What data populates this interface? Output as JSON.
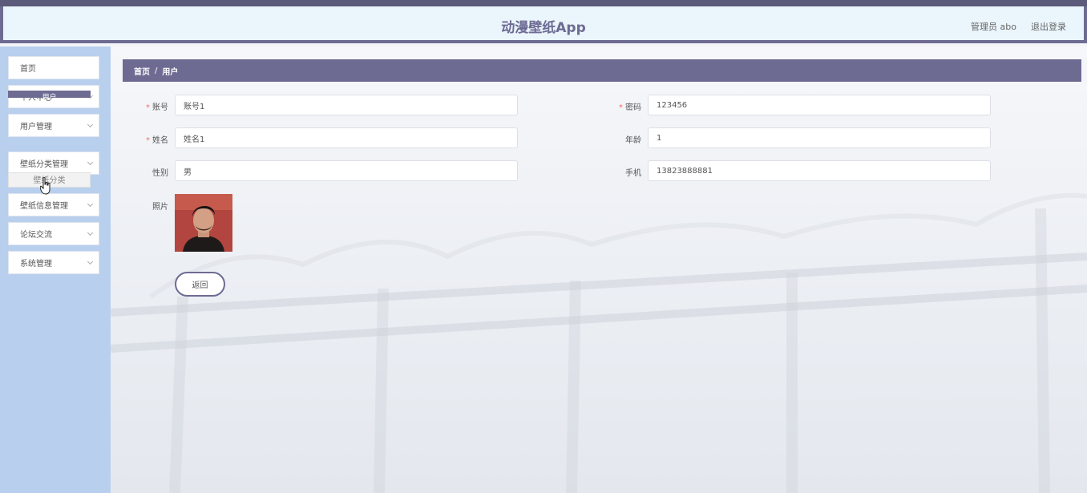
{
  "header": {
    "app_title": "动漫壁纸App",
    "admin_label": "管理员 abo",
    "logout_label": "退出登录"
  },
  "sidebar": {
    "items": [
      {
        "label": "首页"
      },
      {
        "label": "个人中心"
      },
      {
        "label": "用户管理"
      },
      {
        "label": "壁纸分类管理"
      },
      {
        "label": "壁纸信息管理"
      },
      {
        "label": "论坛交流"
      },
      {
        "label": "系统管理"
      }
    ],
    "submenu_user": "用户",
    "submenu_category": "壁纸分类"
  },
  "breadcrumb": {
    "home": "首页",
    "separator": "/",
    "current": "用户"
  },
  "form": {
    "account": {
      "label": "账号",
      "value": "账号1"
    },
    "password": {
      "label": "密码",
      "value": "123456"
    },
    "name": {
      "label": "姓名",
      "value": "姓名1"
    },
    "age": {
      "label": "年龄",
      "value": "1"
    },
    "gender": {
      "label": "性别",
      "value": "男"
    },
    "phone": {
      "label": "手机",
      "value": "13823888881"
    },
    "photo_label": "照片",
    "required_mark": "*"
  },
  "actions": {
    "back_label": "返回"
  },
  "colors": {
    "accent": "#6e6b93",
    "sidebar_bg": "#b8cfee",
    "header_bg": "#eaf5fc",
    "required": "#f56c6c"
  }
}
